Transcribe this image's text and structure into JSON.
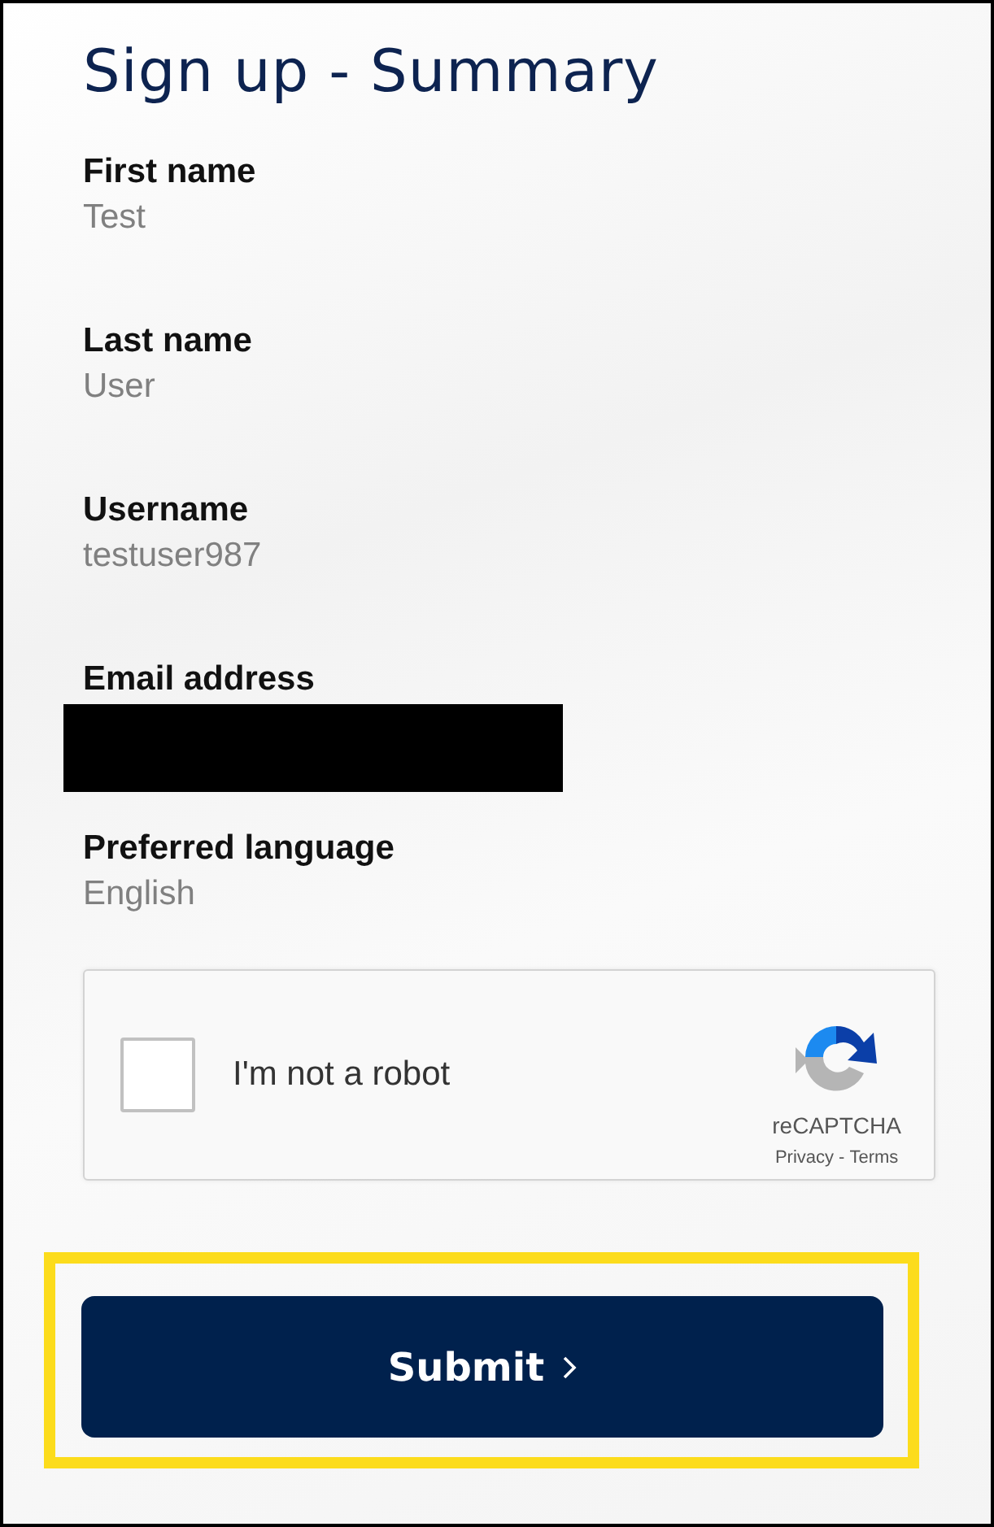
{
  "title": "Sign up - Summary",
  "fields": [
    {
      "label": "First name",
      "kind": "text",
      "value": "Test"
    },
    {
      "label": "Last name",
      "kind": "text",
      "value": "User"
    },
    {
      "label": "Username",
      "kind": "text",
      "value": "testuser987"
    },
    {
      "label": "Email address",
      "kind": "redacted"
    },
    {
      "label": "Preferred language",
      "kind": "text",
      "value": "English"
    }
  ],
  "captcha": {
    "label": "I'm not a robot",
    "checked": false,
    "brand": "reCAPTCHA",
    "privacy": "Privacy",
    "separator": "-",
    "terms": "Terms"
  },
  "submit": {
    "label": "Submit",
    "highlighted": true
  }
}
